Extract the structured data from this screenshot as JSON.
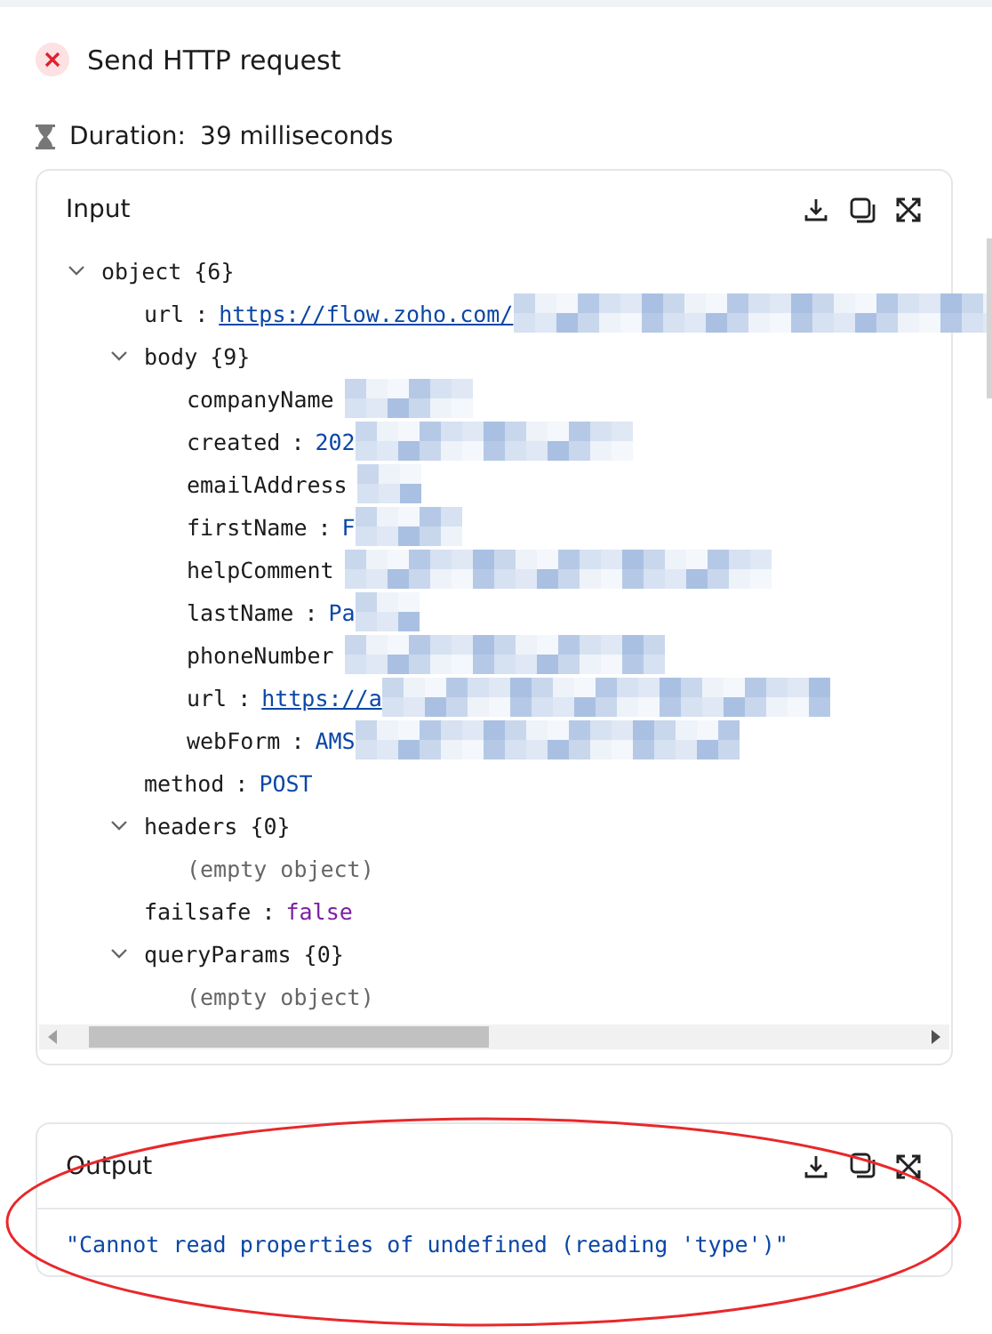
{
  "step": {
    "title": "Send HTTP request",
    "failed": true
  },
  "duration": {
    "label": "Duration:",
    "value": "39 milliseconds"
  },
  "input": {
    "title": "Input",
    "tree": {
      "key": "object",
      "count": "{6}",
      "expanded": true,
      "children": [
        {
          "key": "url",
          "sep": ":",
          "value": "https://flow.zoho.com/",
          "kind": "link",
          "redacted": true
        },
        {
          "key": "body",
          "count": "{9}",
          "expanded": true,
          "children": [
            {
              "key": "companyName",
              "redacted": true
            },
            {
              "key": "created",
              "sep": ":",
              "value": "202",
              "kind": "string",
              "redacted": true
            },
            {
              "key": "emailAddress",
              "redacted": true
            },
            {
              "key": "firstName",
              "sep": ":",
              "value": "F",
              "kind": "string",
              "redacted": true
            },
            {
              "key": "helpComment",
              "redacted": true
            },
            {
              "key": "lastName",
              "sep": ":",
              "value": "Pa",
              "kind": "string",
              "redacted": true
            },
            {
              "key": "phoneNumber",
              "redacted": true
            },
            {
              "key": "url",
              "sep": ":",
              "value": "https://a",
              "kind": "link",
              "redacted": true
            },
            {
              "key": "webForm",
              "sep": ":",
              "value": "AMS",
              "kind": "string",
              "redacted": true
            }
          ]
        },
        {
          "key": "method",
          "sep": ":",
          "value": "POST",
          "kind": "string"
        },
        {
          "key": "headers",
          "count": "{0}",
          "expanded": true,
          "children": [
            {
              "kind": "empty",
              "value": "(empty object)"
            }
          ]
        },
        {
          "key": "failsafe",
          "sep": ":",
          "value": "false",
          "kind": "boolean"
        },
        {
          "key": "queryParams",
          "count": "{0}",
          "expanded": true,
          "children": [
            {
              "kind": "empty",
              "value": "(empty object)"
            }
          ]
        }
      ]
    }
  },
  "output": {
    "title": "Output",
    "value": "\"Cannot read properties of undefined (reading 'type')\"",
    "highlighted": true
  }
}
